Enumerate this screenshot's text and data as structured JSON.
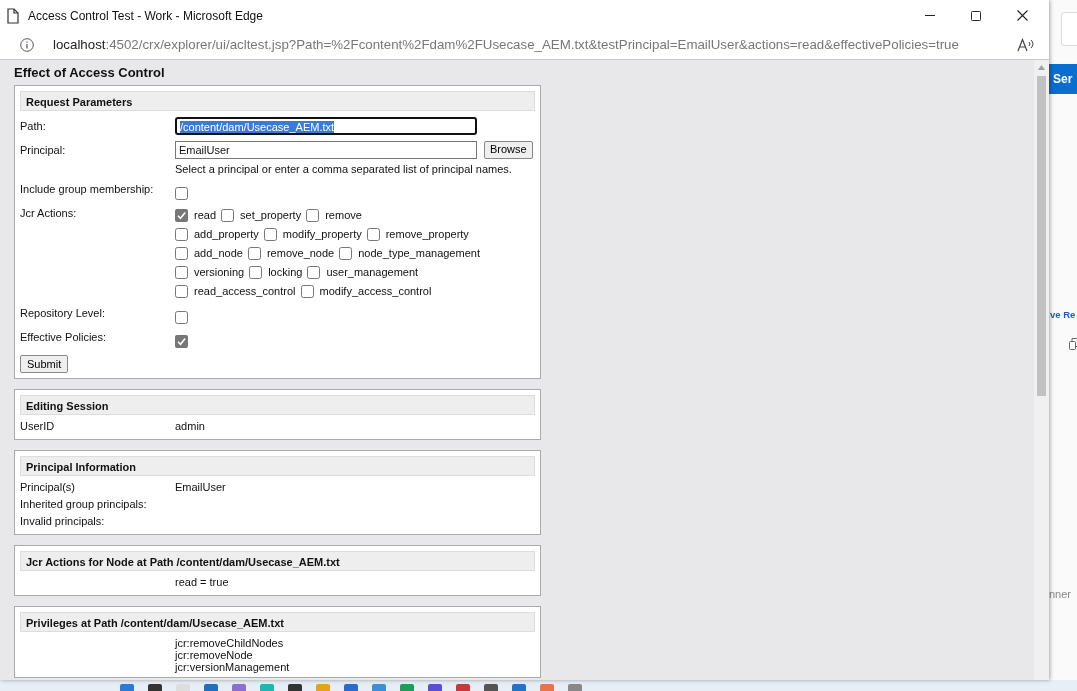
{
  "window": {
    "title": "Access Control Test - Work - Microsoft Edge"
  },
  "address_bar": {
    "host": "localhost",
    "path": ":4502/crx/explorer/ui/acltest.jsp?Path=%2Fcontent%2Fdam%2FUsecase_AEM.txt&testPrincipal=EmailUser&actions=read&effectivePolicies=true"
  },
  "page": {
    "heading": "Effect of Access Control",
    "sections": [
      {
        "kind": "form",
        "title": "Request Parameters",
        "submit": "Submit",
        "rows": [
          {
            "kind": "text_input",
            "label": "Path:",
            "value": "/content/dam/Usecase_AEM.txt",
            "focused": true
          },
          {
            "kind": "text_input",
            "label": "Principal:",
            "value": "EmailUser",
            "focused": false,
            "button": "Browse",
            "hint": "Select a principal or enter a comma separated list of principal names."
          },
          {
            "kind": "checkbox",
            "label": "Include group membership:",
            "checked": false
          },
          {
            "kind": "checkbox_group",
            "label": "Jcr Actions:",
            "lines": [
              [
                {
                  "label": "read",
                  "checked": true
                },
                {
                  "label": "set_property",
                  "checked": false
                },
                {
                  "label": "remove",
                  "checked": false
                }
              ],
              [
                {
                  "label": "add_property",
                  "checked": false
                },
                {
                  "label": "modify_property",
                  "checked": false
                },
                {
                  "label": "remove_property",
                  "checked": false
                }
              ],
              [
                {
                  "label": "add_node",
                  "checked": false
                },
                {
                  "label": "remove_node",
                  "checked": false
                },
                {
                  "label": "node_type_management",
                  "checked": false
                }
              ],
              [
                {
                  "label": "versioning",
                  "checked": false
                },
                {
                  "label": "locking",
                  "checked": false
                },
                {
                  "label": "user_management",
                  "checked": false
                }
              ],
              [
                {
                  "label": "read_access_control",
                  "checked": false
                },
                {
                  "label": "modify_access_control",
                  "checked": false
                }
              ]
            ]
          },
          {
            "kind": "checkbox",
            "label": "Repository Level:",
            "checked": false
          },
          {
            "kind": "checkbox",
            "label": "Effective Policies:",
            "checked": true
          }
        ]
      },
      {
        "kind": "pairs",
        "title": "Editing Session",
        "rows": [
          {
            "label": "UserID",
            "value": "admin"
          }
        ]
      },
      {
        "kind": "pairs",
        "title": "Principal Information",
        "rows": [
          {
            "label": "Principal(s)",
            "value": "EmailUser"
          },
          {
            "label": "Inherited group principals:"
          },
          {
            "label": "Invalid principals:"
          }
        ]
      },
      {
        "kind": "pairs",
        "title": "Jcr Actions for Node at Path /content/dam/Usecase_AEM.txt",
        "rows": [
          {
            "value": "read = true"
          }
        ]
      },
      {
        "kind": "list",
        "title": "Privileges at Path /content/dam/Usecase_AEM.txt",
        "values": [
          "jcr:removeChildNodes",
          "jcr:removeNode",
          "jcr:versionManagement"
        ]
      }
    ]
  },
  "background_page": {
    "button": "Ser",
    "link": "ve Re",
    "footer": "nner"
  }
}
